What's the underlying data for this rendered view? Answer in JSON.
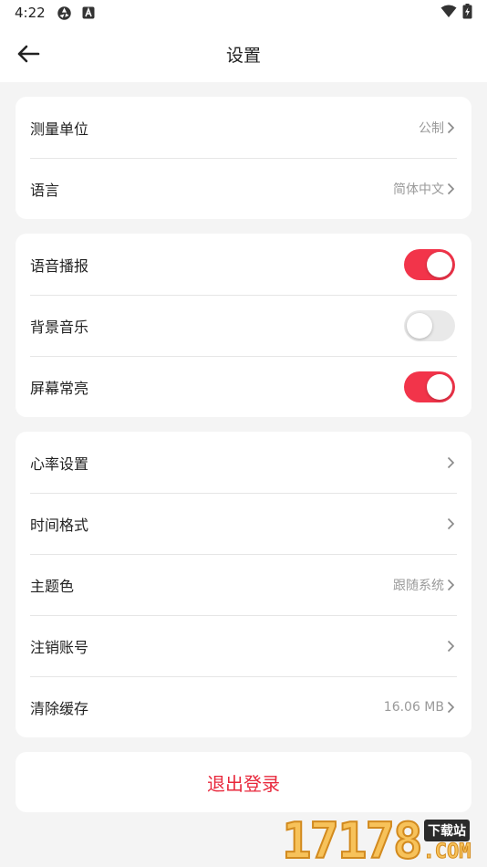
{
  "status_bar": {
    "time": "4:22",
    "icons_left": [
      "aperture-icon",
      "app-a-icon"
    ],
    "icons_right": [
      "wifi-icon",
      "battery-charging-icon"
    ]
  },
  "app_bar": {
    "title": "设置",
    "back_icon": "arrow-left-icon"
  },
  "group1": {
    "measure_unit": {
      "label": "测量单位",
      "value": "公制"
    },
    "language": {
      "label": "语言",
      "value": "简体中文"
    }
  },
  "group2": {
    "voice_broadcast": {
      "label": "语音播报",
      "on": true
    },
    "bg_music": {
      "label": "背景音乐",
      "on": false
    },
    "screen_on": {
      "label": "屏幕常亮",
      "on": true
    }
  },
  "group3": {
    "heart_rate": {
      "label": "心率设置",
      "value": ""
    },
    "time_format": {
      "label": "时间格式",
      "value": ""
    },
    "theme_color": {
      "label": "主题色",
      "value": "跟随系统"
    },
    "cancel_account": {
      "label": "注销账号",
      "value": ""
    },
    "clear_cache": {
      "label": "清除缓存",
      "value": "16.06 MB"
    }
  },
  "logout": {
    "label": "退出登录"
  },
  "watermark": {
    "digits": "17178",
    "tag": "下载站",
    "com": ".COM"
  },
  "colors": {
    "accent": "#f2344a",
    "logout_text": "#e8283c",
    "toggle_off": "#e9e9e9",
    "background": "#f4f4f4"
  }
}
